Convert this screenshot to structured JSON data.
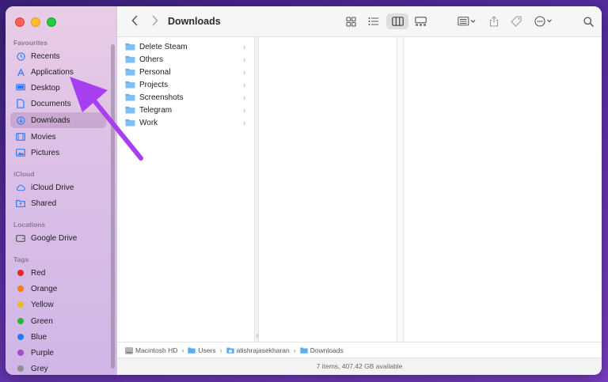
{
  "window": {
    "title": "Downloads"
  },
  "sidebar": {
    "sections": [
      {
        "label": "Favourites"
      },
      {
        "label": "iCloud"
      },
      {
        "label": "Locations"
      },
      {
        "label": "Tags"
      }
    ],
    "favourites": [
      {
        "label": "Recents",
        "icon": "clock-icon"
      },
      {
        "label": "Applications",
        "icon": "applications-icon"
      },
      {
        "label": "Desktop",
        "icon": "desktop-icon"
      },
      {
        "label": "Documents",
        "icon": "document-icon"
      },
      {
        "label": "Downloads",
        "icon": "download-icon",
        "active": true
      },
      {
        "label": "Movies",
        "icon": "film-icon"
      },
      {
        "label": "Pictures",
        "icon": "photo-icon"
      }
    ],
    "icloud": [
      {
        "label": "iCloud Drive",
        "icon": "cloud-icon"
      },
      {
        "label": "Shared",
        "icon": "shared-folder-icon"
      }
    ],
    "locations": [
      {
        "label": "Google Drive",
        "icon": "drive-icon"
      }
    ],
    "tags": [
      {
        "label": "Red",
        "color": "#e5262a"
      },
      {
        "label": "Orange",
        "color": "#f57f16"
      },
      {
        "label": "Yellow",
        "color": "#f2b71b"
      },
      {
        "label": "Green",
        "color": "#2cb334"
      },
      {
        "label": "Blue",
        "color": "#1f7cf2"
      },
      {
        "label": "Purple",
        "color": "#a24ad0"
      },
      {
        "label": "Grey",
        "color": "#8e8e93"
      }
    ]
  },
  "folders": [
    {
      "label": "Delete Steam"
    },
    {
      "label": "Others"
    },
    {
      "label": "Personal"
    },
    {
      "label": "Projects"
    },
    {
      "label": "Screenshots"
    },
    {
      "label": "Telegram"
    },
    {
      "label": "Work"
    }
  ],
  "pathbar": {
    "segments": [
      {
        "label": "Macintosh HD",
        "icon": "hard-drive-icon"
      },
      {
        "label": "Users",
        "icon": "folder-icon"
      },
      {
        "label": "atishrajasekharan",
        "icon": "home-folder-icon"
      },
      {
        "label": "Downloads",
        "icon": "folder-icon"
      }
    ]
  },
  "status": {
    "text": "7 items, 407.42 GB available"
  },
  "colors": {
    "accent": "#2f7bf6",
    "folder": "#5aaef0",
    "arrow": "#a73ff0"
  }
}
